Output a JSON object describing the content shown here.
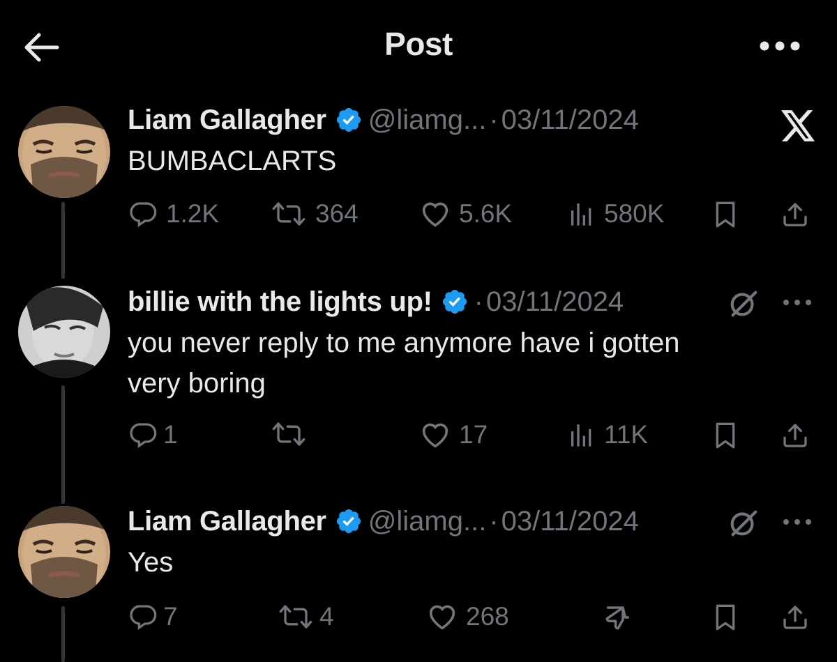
{
  "header": {
    "title": "Post",
    "back_icon": "arrow-left-icon",
    "more_icon": "more-horizontal-icon"
  },
  "colors": {
    "background": "#000000",
    "text": "#e7e9ea",
    "muted": "#71767b",
    "verified": "#1d9bf0"
  },
  "posts": [
    {
      "name": "Liam Gallagher",
      "handle": "@liamg...",
      "sep": "·",
      "date": "03/11/2024",
      "text": "BUMBACLARTS",
      "corner_icon": "x-logo-icon",
      "stats": {
        "replies": "1.2K",
        "reposts": "364",
        "likes": "5.6K",
        "views": "580K"
      }
    },
    {
      "name": "billie with the lights up!",
      "sep": "·",
      "date": "03/11/2024",
      "text_line1": "you never reply to me anymore have i gotten",
      "text_line2": "very boring",
      "corner_icon": "grok-icon",
      "stats": {
        "replies": "1",
        "reposts": "",
        "likes": "17",
        "views": "11K"
      }
    },
    {
      "name": "Liam Gallagher",
      "handle": "@liamg...",
      "sep": "·",
      "date": "03/11/2024",
      "text": "Yes",
      "corner_icon": "grok-icon",
      "stats": {
        "replies": "7",
        "reposts": "4",
        "likes": "268"
      },
      "extra_icon": "thumbs-down-icon"
    }
  ]
}
